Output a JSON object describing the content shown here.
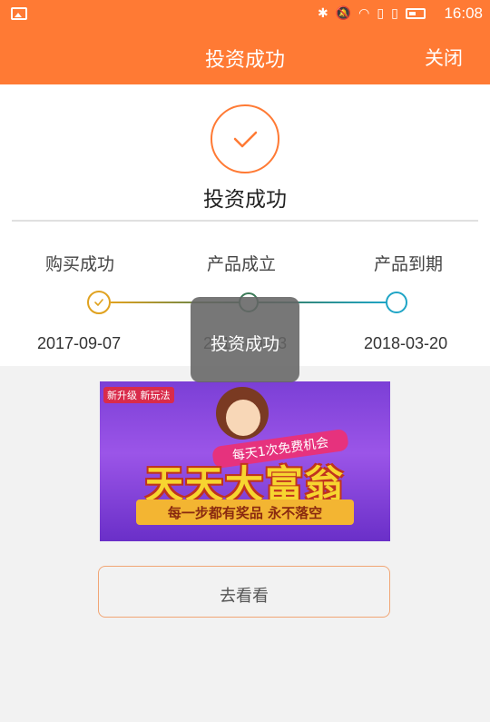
{
  "status_bar": {
    "time": "16:08",
    "icons": [
      "image-icon",
      "bluetooth-icon",
      "mute-icon",
      "wifi-icon",
      "sim-icon",
      "sim-icon",
      "battery-icon"
    ]
  },
  "nav": {
    "title": "投资成功",
    "close_label": "关闭"
  },
  "result": {
    "title": "投资成功"
  },
  "timeline": {
    "steps": [
      {
        "label": "购买成功",
        "date": "2017-09-07"
      },
      {
        "label": "产品成立",
        "date": "2017-09-13"
      },
      {
        "label": "产品到期",
        "date": "2018-03-20"
      }
    ]
  },
  "toast": {
    "text": "投资成功"
  },
  "banner": {
    "tag": "新升级 新玩法",
    "subtitle": "每天1次免费机会",
    "title": "天天大富翁",
    "slogan": "每一步都有奖品 永不落空"
  },
  "action": {
    "button_label": "去看看"
  },
  "colors": {
    "accent": "#ff7a34",
    "step1": "#e0a21f",
    "step2": "#3c7a58",
    "step3": "#1fa5c6"
  }
}
